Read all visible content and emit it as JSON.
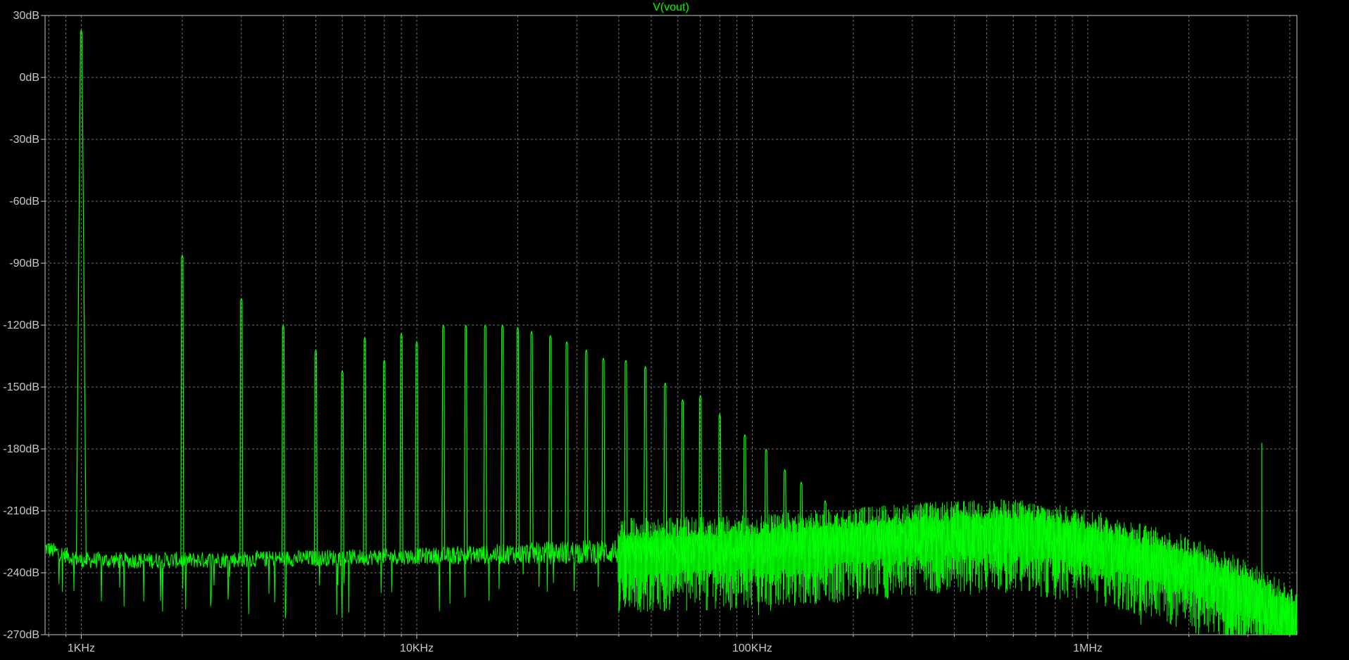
{
  "chart_data": {
    "type": "line",
    "title": "V(vout)",
    "x_scale": "log",
    "xlim_hz": [
      780,
      4200000
    ],
    "ylim_db": [
      -270,
      30
    ],
    "y_ticks": [
      {
        "value": 30,
        "label": "30dB"
      },
      {
        "value": 0,
        "label": "0dB"
      },
      {
        "value": -30,
        "label": "-30dB"
      },
      {
        "value": -60,
        "label": "-60dB"
      },
      {
        "value": -90,
        "label": "-90dB"
      },
      {
        "value": -120,
        "label": "-120dB"
      },
      {
        "value": -150,
        "label": "-150dB"
      },
      {
        "value": -180,
        "label": "-180dB"
      },
      {
        "value": -210,
        "label": "-210dB"
      },
      {
        "value": -240,
        "label": "-240dB"
      },
      {
        "value": -270,
        "label": "-270dB"
      }
    ],
    "x_ticks": [
      {
        "value": 1000,
        "label": "1KHz"
      },
      {
        "value": 10000,
        "label": "10KHz"
      },
      {
        "value": 100000,
        "label": "100KHz"
      },
      {
        "value": 1000000,
        "label": "1MHz"
      }
    ],
    "grid": true,
    "series": [
      {
        "name": "V(vout)",
        "color": "#00ff00",
        "noise_floor_db": [
          [
            780,
            -228
          ],
          [
            1000,
            -234
          ],
          [
            2000,
            -234
          ],
          [
            10000,
            -232
          ],
          [
            30000,
            -230
          ],
          [
            100000,
            -228
          ],
          [
            300000,
            -222
          ],
          [
            600000,
            -220
          ],
          [
            1000000,
            -225
          ],
          [
            2000000,
            -238
          ],
          [
            3000000,
            -250
          ],
          [
            4000000,
            -262
          ]
        ],
        "harmonics": [
          {
            "f_hz": 1000,
            "db": 23
          },
          {
            "f_hz": 2000,
            "db": -86
          },
          {
            "f_hz": 3000,
            "db": -107
          },
          {
            "f_hz": 4000,
            "db": -120
          },
          {
            "f_hz": 5000,
            "db": -132
          },
          {
            "f_hz": 6000,
            "db": -142
          },
          {
            "f_hz": 7000,
            "db": -126
          },
          {
            "f_hz": 8000,
            "db": -137
          },
          {
            "f_hz": 9000,
            "db": -124
          },
          {
            "f_hz": 10000,
            "db": -128
          },
          {
            "f_hz": 12000,
            "db": -120
          },
          {
            "f_hz": 14000,
            "db": -120
          },
          {
            "f_hz": 16000,
            "db": -120
          },
          {
            "f_hz": 18000,
            "db": -120
          },
          {
            "f_hz": 20000,
            "db": -121
          },
          {
            "f_hz": 22000,
            "db": -123
          },
          {
            "f_hz": 25000,
            "db": -125
          },
          {
            "f_hz": 28000,
            "db": -128
          },
          {
            "f_hz": 32000,
            "db": -132
          },
          {
            "f_hz": 36000,
            "db": -136
          },
          {
            "f_hz": 42000,
            "db": -137
          },
          {
            "f_hz": 48000,
            "db": -140
          },
          {
            "f_hz": 55000,
            "db": -148
          },
          {
            "f_hz": 62000,
            "db": -156
          },
          {
            "f_hz": 70000,
            "db": -154
          },
          {
            "f_hz": 80000,
            "db": -163
          },
          {
            "f_hz": 95000,
            "db": -173
          },
          {
            "f_hz": 110000,
            "db": -180
          },
          {
            "f_hz": 125000,
            "db": -190
          },
          {
            "f_hz": 140000,
            "db": -196
          },
          {
            "f_hz": 165000,
            "db": -205
          }
        ],
        "spurs": [
          {
            "f_hz": 3300000,
            "db": -177
          }
        ]
      }
    ]
  }
}
